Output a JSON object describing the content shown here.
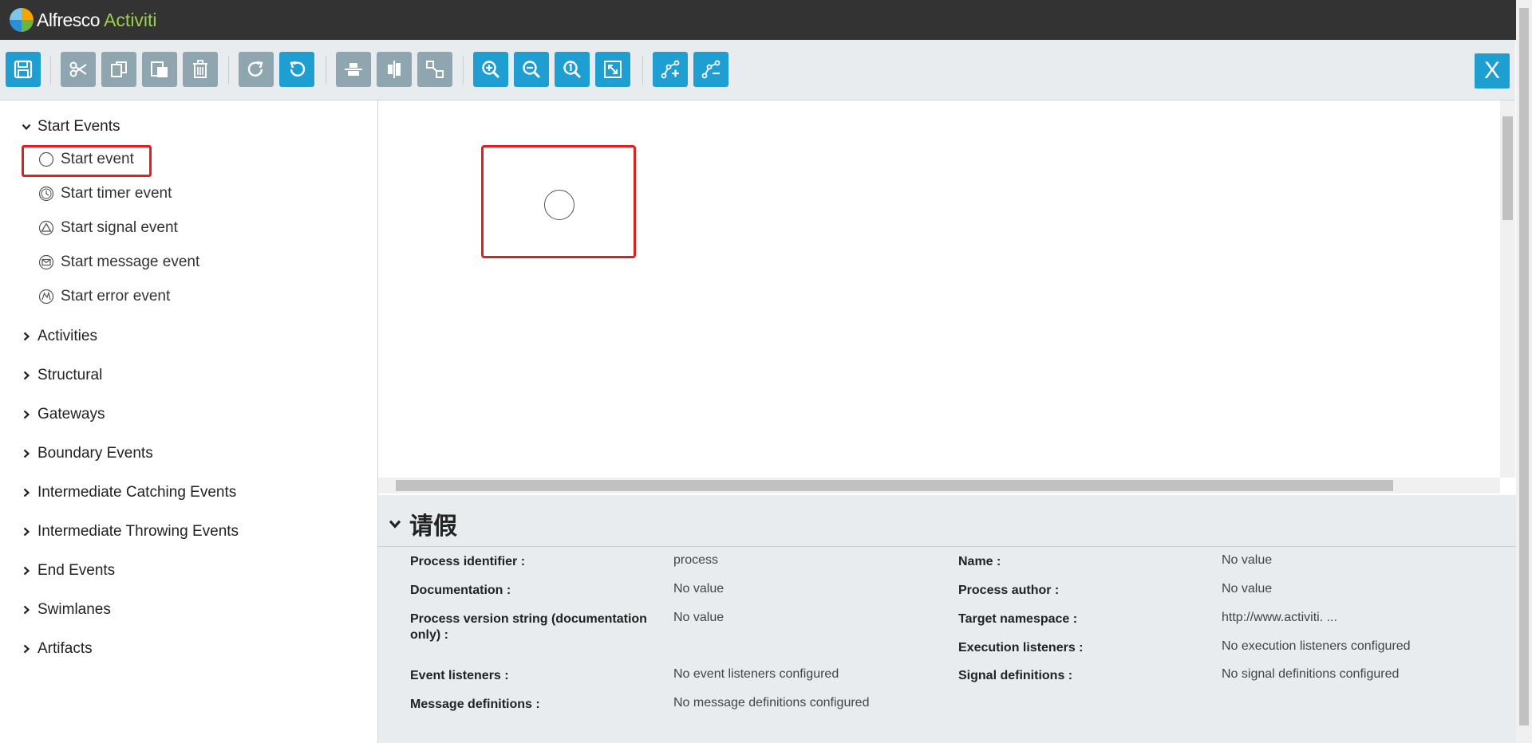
{
  "app": {
    "brand_part1": "Alfresco",
    "brand_part2": "Activiti"
  },
  "toolbar": {
    "close_label": "X",
    "buttons": [
      {
        "name": "save",
        "icon": "save-icon",
        "state": "active"
      },
      {
        "name": "cut",
        "icon": "scissors-icon",
        "state": "disabled"
      },
      {
        "name": "copy",
        "icon": "copy-icon",
        "state": "disabled"
      },
      {
        "name": "paste",
        "icon": "paste-icon",
        "state": "disabled"
      },
      {
        "name": "delete",
        "icon": "trash-icon",
        "state": "disabled"
      },
      {
        "name": "redo",
        "icon": "redo-icon",
        "state": "disabled"
      },
      {
        "name": "undo",
        "icon": "undo-icon",
        "state": "active"
      },
      {
        "name": "align-horizontal",
        "icon": "align-horizontal-icon",
        "state": "disabled"
      },
      {
        "name": "align-vertical",
        "icon": "align-vertical-icon",
        "state": "disabled"
      },
      {
        "name": "same-size",
        "icon": "same-size-icon",
        "state": "disabled"
      },
      {
        "name": "zoom-in",
        "icon": "zoom-in-icon",
        "state": "active"
      },
      {
        "name": "zoom-out",
        "icon": "zoom-out-icon",
        "state": "active"
      },
      {
        "name": "zoom-actual",
        "icon": "zoom-actual-icon",
        "state": "active"
      },
      {
        "name": "zoom-fit",
        "icon": "zoom-fit-icon",
        "state": "active"
      },
      {
        "name": "add-bendpoint",
        "icon": "add-bendpoint-icon",
        "state": "active"
      },
      {
        "name": "remove-bendpoint",
        "icon": "remove-bendpoint-icon",
        "state": "active"
      }
    ]
  },
  "palette": {
    "start_events": {
      "label": "Start Events",
      "expanded": true,
      "items": [
        {
          "label": "Start event",
          "icon": "start-event-icon",
          "selected": true
        },
        {
          "label": "Start timer event",
          "icon": "timer-event-icon"
        },
        {
          "label": "Start signal event",
          "icon": "signal-event-icon"
        },
        {
          "label": "Start message event",
          "icon": "message-event-icon"
        },
        {
          "label": "Start error event",
          "icon": "error-event-icon"
        }
      ]
    },
    "groups": [
      "Activities",
      "Structural",
      "Gateways",
      "Boundary Events",
      "Intermediate Catching Events",
      "Intermediate Throwing Events",
      "End Events",
      "Swimlanes",
      "Artifacts"
    ]
  },
  "properties": {
    "title": "请假",
    "fields": [
      {
        "label": "Process identifier :",
        "value": "process"
      },
      {
        "label": "Name :",
        "value": "No value"
      },
      {
        "label": "Documentation :",
        "value": "No value"
      },
      {
        "label": "Process author :",
        "value": "No value"
      },
      {
        "label": "Process version string (documentation only) :",
        "value": "No value"
      },
      {
        "label": "Target namespace :",
        "value": "http://www.activiti. ..."
      },
      {
        "label": "Execution listeners :",
        "value": "No execution listeners configured"
      },
      {
        "label": "Event listeners :",
        "value": "No event listeners configured"
      },
      {
        "label": "Signal definitions :",
        "value": "No signal definitions configured"
      },
      {
        "label": "Message definitions :",
        "value": "No message definitions configured"
      }
    ]
  }
}
